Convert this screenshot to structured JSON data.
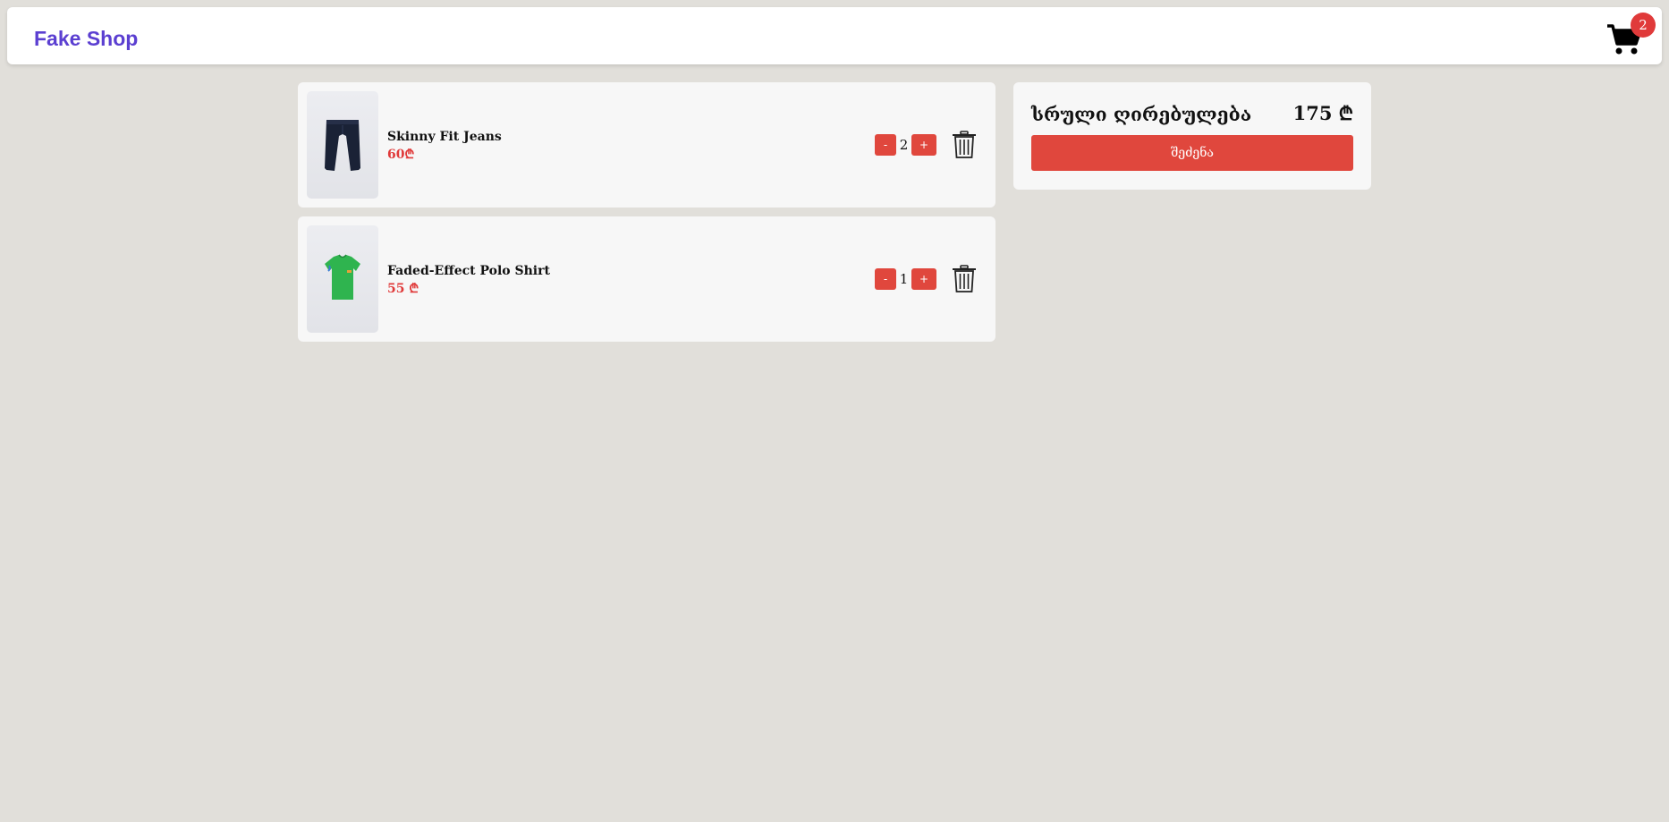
{
  "app": {
    "title": "Fake Shop"
  },
  "cart": {
    "count": "2",
    "icon": "cart-icon"
  },
  "items": [
    {
      "name": "Skinny Fit Jeans",
      "price": "60₾",
      "qty": "2",
      "minus": "-",
      "plus": "+",
      "icon": "trash-icon"
    },
    {
      "name": "Faded-Effect Polo Shirt",
      "price": "55 ₾",
      "qty": "1",
      "minus": "-",
      "plus": "+",
      "icon": "trash-icon"
    }
  ],
  "summary": {
    "label": "სრული ღირებულება",
    "total": "175 ₾",
    "buy_label": "შეძენა"
  },
  "colors": {
    "accent": "#e0473d",
    "brand": "#5b3fd1",
    "background": "#e1dfda"
  }
}
